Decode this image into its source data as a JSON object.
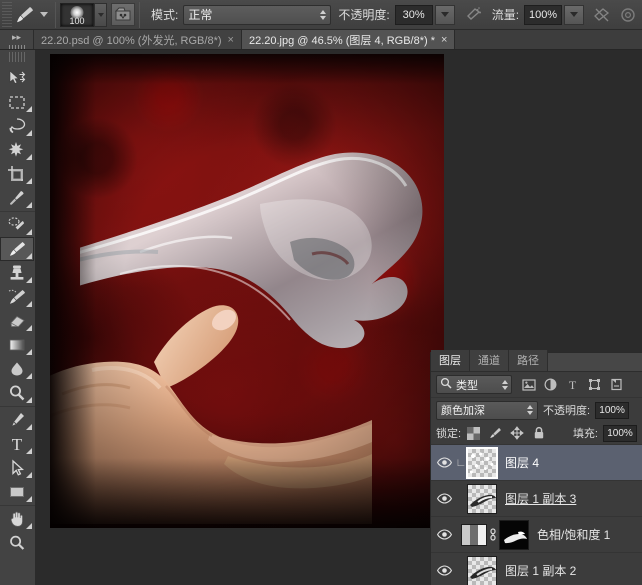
{
  "options_bar": {
    "tool_icon": "brush-icon",
    "brush_size": "100",
    "brush_panel_icon": "brush-panel-icon",
    "mode_label": "模式:",
    "mode_value": "正常",
    "opacity_label": "不透明度:",
    "opacity_value": "30%",
    "airbrush_icon": "airbrush-icon",
    "flow_label": "流量:",
    "flow_value": "100%",
    "smoothing_icon": "smoothing-icon",
    "extra_icon": "tablet-pressure-icon"
  },
  "tabs": {
    "grip_icon": "expand-arrows-icon",
    "items": [
      {
        "title": "22.20.psd @ 100% (外发光, RGB/8*)",
        "close": "×",
        "active": false
      },
      {
        "title": "22.20.jpg @ 46.5% (图层 4, RGB/8*) *",
        "close": "×",
        "active": true
      }
    ]
  },
  "toolbar": {
    "groups": [
      [
        {
          "name": "move-tool-icon",
          "selected": false,
          "has_corner": false
        },
        {
          "name": "rectangular-marquee-tool-icon",
          "selected": false,
          "has_corner": true
        },
        {
          "name": "lasso-tool-icon",
          "selected": false,
          "has_corner": true
        },
        {
          "name": "magic-wand-tool-icon",
          "selected": false,
          "has_corner": true
        },
        {
          "name": "crop-tool-icon",
          "selected": false,
          "has_corner": true
        },
        {
          "name": "eyedropper-tool-icon",
          "selected": false,
          "has_corner": true
        }
      ],
      [
        {
          "name": "spot-healing-brush-tool-icon",
          "selected": false,
          "has_corner": true
        },
        {
          "name": "brush-tool-icon",
          "selected": true,
          "has_corner": true
        },
        {
          "name": "clone-stamp-tool-icon",
          "selected": false,
          "has_corner": true
        },
        {
          "name": "history-brush-tool-icon",
          "selected": false,
          "has_corner": true
        },
        {
          "name": "eraser-tool-icon",
          "selected": false,
          "has_corner": true
        },
        {
          "name": "gradient-tool-icon",
          "selected": false,
          "has_corner": true
        },
        {
          "name": "blur-tool-icon",
          "selected": false,
          "has_corner": true
        },
        {
          "name": "dodge-tool-icon",
          "selected": false,
          "has_corner": true
        }
      ],
      [
        {
          "name": "pen-tool-icon",
          "selected": false,
          "has_corner": true
        },
        {
          "name": "type-tool-icon",
          "selected": false,
          "has_corner": true
        },
        {
          "name": "path-selection-tool-icon",
          "selected": false,
          "has_corner": true
        },
        {
          "name": "rectangle-tool-icon",
          "selected": false,
          "has_corner": true
        }
      ],
      [
        {
          "name": "hand-tool-icon",
          "selected": false,
          "has_corner": true
        },
        {
          "name": "zoom-tool-icon",
          "selected": false,
          "has_corner": false
        }
      ]
    ]
  },
  "canvas": {
    "document_name": "22.20.jpg",
    "zoom": "46.5%",
    "artwork_description": "human hand holding a transparent glass hand on dark red textured background"
  },
  "layers_panel": {
    "tabs": [
      {
        "label": "图层",
        "active": true
      },
      {
        "label": "通道",
        "active": false
      },
      {
        "label": "路径",
        "active": false
      }
    ],
    "filter": {
      "search_icon": "search-icon",
      "type_value": "类型",
      "icons": [
        "pixel-layer-filter-icon",
        "adjustment-layer-filter-icon",
        "type-layer-filter-icon",
        "shape-layer-filter-icon",
        "smart-object-filter-icon"
      ]
    },
    "blend": {
      "mode": "颜色加深",
      "opacity_label": "不透明度:",
      "opacity_value": "100%"
    },
    "lock": {
      "label": "锁定:",
      "icons": [
        "lock-transparent-pixels-icon",
        "lock-image-pixels-icon",
        "lock-position-icon",
        "lock-all-icon"
      ],
      "fill_label": "填充:",
      "fill_value": "100%"
    },
    "layers": [
      {
        "name": "图层 4",
        "visible": true,
        "selected": true,
        "clipped": true,
        "kind": "pixel",
        "thumb_selected": true,
        "underline": false
      },
      {
        "name": "图层 1 副本 3",
        "visible": true,
        "selected": false,
        "clipped": false,
        "kind": "pixel",
        "thumb_selected": false,
        "underline": true
      },
      {
        "name": "色相/饱和度 1",
        "visible": true,
        "selected": false,
        "clipped": false,
        "kind": "adjustment",
        "thumb_selected": false,
        "underline": false
      },
      {
        "name": "图层 1 副本 2",
        "visible": true,
        "selected": false,
        "clipped": false,
        "kind": "pixel",
        "thumb_selected": false,
        "underline": false
      }
    ],
    "eye_icon": "eye-icon",
    "link_icon": "link-icon",
    "clip_icon": "clipping-mask-arrow-icon"
  },
  "colors": {
    "panel_bg": "#3c3c3c",
    "toolbar_bg": "#434343",
    "canvas_bg": "#2b2b2b",
    "selected_layer": "#5b6170",
    "artwork_red": "#7a1210"
  }
}
